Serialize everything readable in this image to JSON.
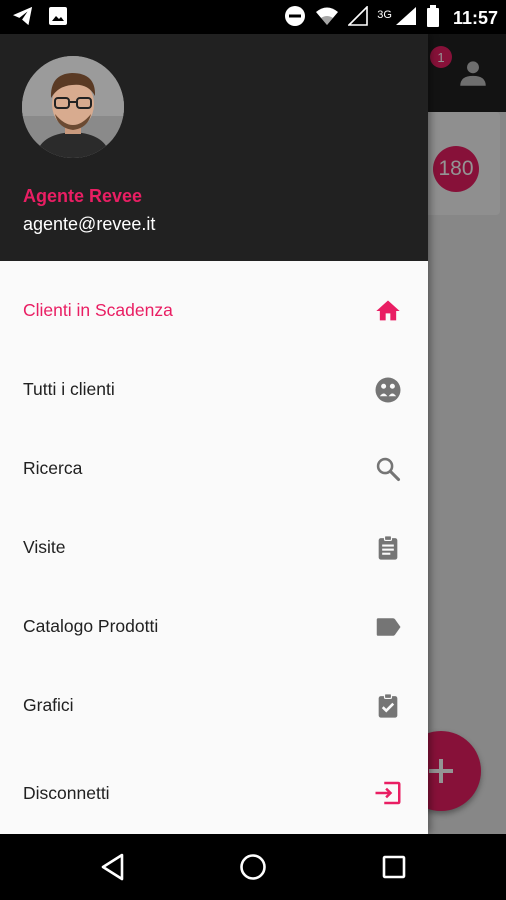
{
  "status_bar": {
    "time": "11:57",
    "network_label": "3G",
    "left_icons": [
      "telegram-icon",
      "image-icon"
    ],
    "right_icons": [
      "do-not-disturb-icon",
      "wifi-icon",
      "signal-icon",
      "battery-icon"
    ]
  },
  "background": {
    "notification_count": "1",
    "card_value": "180",
    "fab_icon": "plus-icon"
  },
  "drawer": {
    "user": {
      "name": "Agente Revee",
      "email": "agente@revee.it"
    },
    "items": [
      {
        "label": "Clienti in Scadenza",
        "icon": "home-icon",
        "active": true
      },
      {
        "label": "Tutti i clienti",
        "icon": "clients-icon",
        "active": false
      },
      {
        "label": "Ricerca",
        "icon": "search-icon",
        "active": false
      },
      {
        "label": "Visite",
        "icon": "clipboard-icon",
        "active": false
      },
      {
        "label": "Catalogo Prodotti",
        "icon": "label-tag-icon",
        "active": false
      },
      {
        "label": "Grafici",
        "icon": "clipboard-check-icon",
        "active": false
      },
      {
        "label": "Disconnetti",
        "icon": "logout-icon",
        "active": false
      }
    ]
  },
  "colors": {
    "accent": "#e91e63",
    "header_bg": "#212121",
    "icon_gray": "#757575"
  }
}
